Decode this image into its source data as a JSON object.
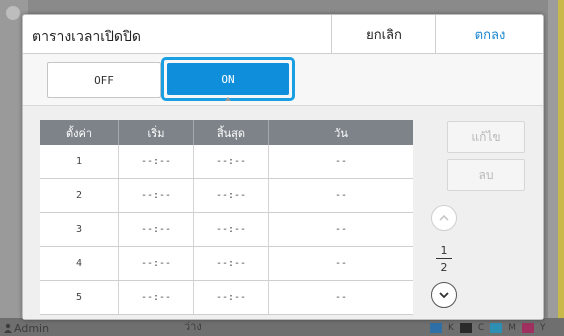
{
  "dialog": {
    "title": "ตารางเวลาเปิดปิด",
    "cancel_label": "ยกเลิก",
    "ok_label": "ตกลง"
  },
  "toggle": {
    "off_label": "OFF",
    "on_label": "ON",
    "selected": "ON"
  },
  "table": {
    "headers": [
      "ตั้งค่า",
      "เริ่ม",
      "สิ้นสุด",
      "วัน"
    ],
    "rows": [
      {
        "setting": "1",
        "start": "--:--",
        "end": "--:--",
        "day": "--"
      },
      {
        "setting": "2",
        "start": "--:--",
        "end": "--:--",
        "day": "--"
      },
      {
        "setting": "3",
        "start": "--:--",
        "end": "--:--",
        "day": "--"
      },
      {
        "setting": "4",
        "start": "--:--",
        "end": "--:--",
        "day": "--"
      },
      {
        "setting": "5",
        "start": "--:--",
        "end": "--:--",
        "day": "--"
      }
    ]
  },
  "side": {
    "edit_label": "แก้ไข",
    "delete_label": "ลบ"
  },
  "pager": {
    "current": "1",
    "total": "2"
  },
  "background": {
    "user": "Admin",
    "status": "ว่าง",
    "ink_labels": [
      "K",
      "C",
      "M",
      "Y"
    ]
  },
  "colors": {
    "accent": "#0f8fdb",
    "ok_text": "#1b86d0",
    "table_header": "#7d8388"
  },
  "icons": {
    "up": "chevron-up-icon",
    "down": "chevron-down-icon",
    "user": "person-icon"
  }
}
